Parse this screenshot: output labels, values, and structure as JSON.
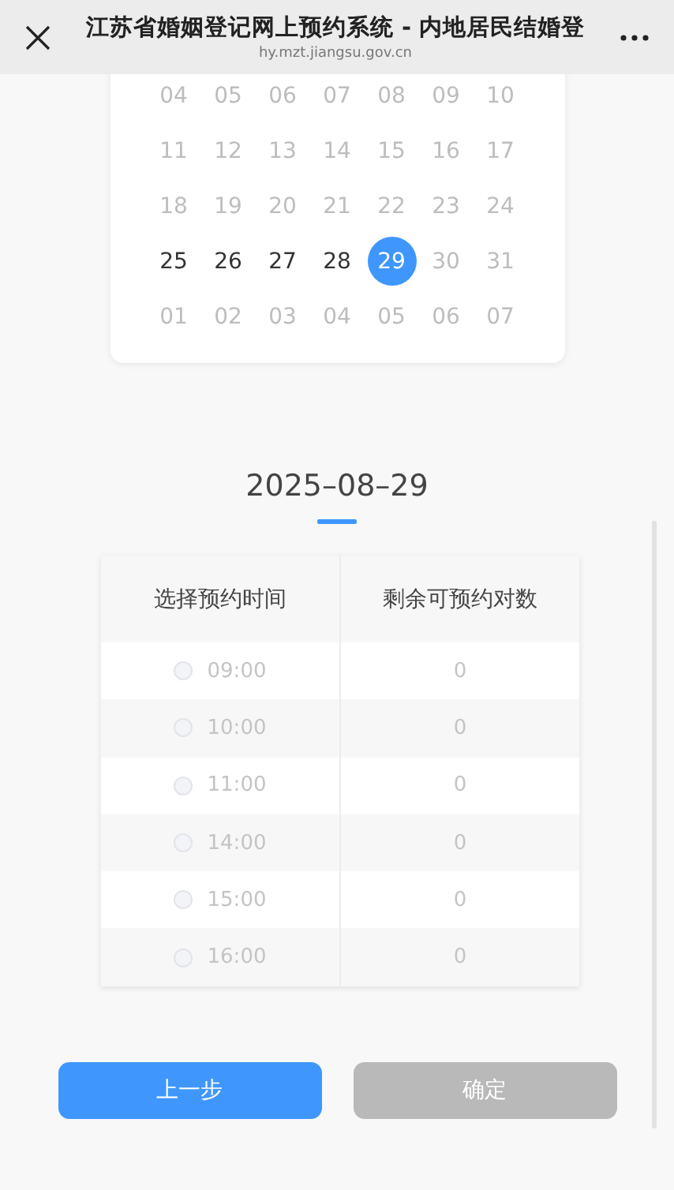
{
  "header": {
    "title": "江苏省婚姻登记网上预约系统 - 内地居民结婚登",
    "url": "hy.mzt.jiangsu.gov.cn"
  },
  "calendar": {
    "weeks": [
      [
        {
          "day": "04",
          "disabled": true,
          "selected": false
        },
        {
          "day": "05",
          "disabled": true,
          "selected": false
        },
        {
          "day": "06",
          "disabled": true,
          "selected": false
        },
        {
          "day": "07",
          "disabled": true,
          "selected": false
        },
        {
          "day": "08",
          "disabled": true,
          "selected": false
        },
        {
          "day": "09",
          "disabled": true,
          "selected": false
        },
        {
          "day": "10",
          "disabled": true,
          "selected": false
        }
      ],
      [
        {
          "day": "11",
          "disabled": true,
          "selected": false
        },
        {
          "day": "12",
          "disabled": true,
          "selected": false
        },
        {
          "day": "13",
          "disabled": true,
          "selected": false
        },
        {
          "day": "14",
          "disabled": true,
          "selected": false
        },
        {
          "day": "15",
          "disabled": true,
          "selected": false
        },
        {
          "day": "16",
          "disabled": true,
          "selected": false
        },
        {
          "day": "17",
          "disabled": true,
          "selected": false
        }
      ],
      [
        {
          "day": "18",
          "disabled": true,
          "selected": false
        },
        {
          "day": "19",
          "disabled": true,
          "selected": false
        },
        {
          "day": "20",
          "disabled": true,
          "selected": false
        },
        {
          "day": "21",
          "disabled": true,
          "selected": false
        },
        {
          "day": "22",
          "disabled": true,
          "selected": false
        },
        {
          "day": "23",
          "disabled": true,
          "selected": false
        },
        {
          "day": "24",
          "disabled": true,
          "selected": false
        }
      ],
      [
        {
          "day": "25",
          "disabled": false,
          "selected": false
        },
        {
          "day": "26",
          "disabled": false,
          "selected": false
        },
        {
          "day": "27",
          "disabled": false,
          "selected": false
        },
        {
          "day": "28",
          "disabled": false,
          "selected": false
        },
        {
          "day": "29",
          "disabled": false,
          "selected": true
        },
        {
          "day": "30",
          "disabled": true,
          "selected": false
        },
        {
          "day": "31",
          "disabled": true,
          "selected": false
        }
      ],
      [
        {
          "day": "01",
          "disabled": true,
          "selected": false
        },
        {
          "day": "02",
          "disabled": true,
          "selected": false
        },
        {
          "day": "03",
          "disabled": true,
          "selected": false
        },
        {
          "day": "04",
          "disabled": true,
          "selected": false
        },
        {
          "day": "05",
          "disabled": true,
          "selected": false
        },
        {
          "day": "06",
          "disabled": true,
          "selected": false
        },
        {
          "day": "07",
          "disabled": true,
          "selected": false
        }
      ]
    ]
  },
  "selected_date": "2025–08–29",
  "table": {
    "columns": [
      "选择预约时间",
      "剩余可预约对数"
    ],
    "rows": [
      {
        "time": "09:00",
        "remaining": "0",
        "disabled": true,
        "selected": false
      },
      {
        "time": "10:00",
        "remaining": "0",
        "disabled": true,
        "selected": false
      },
      {
        "time": "11:00",
        "remaining": "0",
        "disabled": true,
        "selected": false
      },
      {
        "time": "14:00",
        "remaining": "0",
        "disabled": true,
        "selected": false
      },
      {
        "time": "15:00",
        "remaining": "0",
        "disabled": true,
        "selected": false
      },
      {
        "time": "16:00",
        "remaining": "0",
        "disabled": true,
        "selected": false
      }
    ]
  },
  "buttons": [
    {
      "label": "上一步",
      "disabled": false
    },
    {
      "label": "确定",
      "disabled": true
    }
  ]
}
